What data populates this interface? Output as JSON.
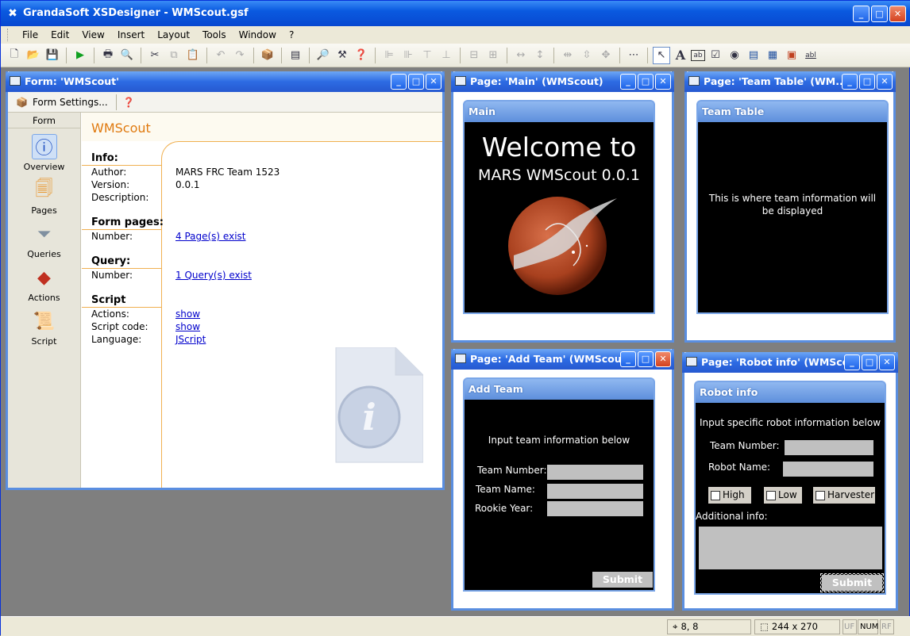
{
  "app": {
    "title": "GrandaSoft XSDesigner - WMScout.gsf"
  },
  "menu": [
    "File",
    "Edit",
    "View",
    "Insert",
    "Layout",
    "Tools",
    "Window",
    "?"
  ],
  "form_window": {
    "title": "Form: 'WMScout'",
    "toolbar_label": "Form Settings...",
    "sidebar_header": "Form",
    "sidebar_items": [
      "Overview",
      "Pages",
      "Queries",
      "Actions",
      "Script"
    ],
    "heading": "WMScout",
    "sections": {
      "info": "Info:",
      "form_pages": "Form pages:",
      "query": "Query:",
      "script": "Script"
    },
    "labels": {
      "author": "Author:",
      "version": "Version:",
      "description": "Description:",
      "pages_number": "Number:",
      "query_number": "Number:",
      "actions": "Actions:",
      "script_code": "Script code:",
      "language": "Language:"
    },
    "values": {
      "author": "MARS FRC Team 1523",
      "version": "0.0.1",
      "pages_link": "4 Page(s) exist",
      "query_link": "1 Query(s) exist",
      "actions_link": "show",
      "script_code_link": "show",
      "language_link": "JScript"
    }
  },
  "page_main": {
    "title": "Page: 'Main' (WMScout)",
    "panel_title": "Main",
    "welcome": "Welcome to",
    "subtitle": "MARS WMScout 0.0.1"
  },
  "page_team_table": {
    "title": "Page: 'Team Table' (WM...",
    "panel_title": "Team Table",
    "text": "This is where team information will be displayed"
  },
  "page_add_team": {
    "title": "Page: 'Add Team' (WMScout)",
    "panel_title": "Add Team",
    "intro": "Input team information below",
    "fields": [
      "Team Number:",
      "Team Name:",
      "Rookie Year:"
    ],
    "submit": "Submit"
  },
  "page_robot_info": {
    "title": "Page: 'Robot info' (WMSco...",
    "panel_title": "Robot info",
    "intro": "Input specific robot information below",
    "fields": [
      "Team Number:",
      "Robot Name:"
    ],
    "checkboxes": [
      "High",
      "Low",
      "Harvester"
    ],
    "additional": "Additional info:",
    "submit": "Submit"
  },
  "status": {
    "position": "8, 8",
    "size": "244 x 270",
    "uf": "UF",
    "num": "NUM",
    "rf": "RF"
  },
  "colors": {
    "titlebar": "#0a5ae0",
    "accent": "#e07a10",
    "link": "#0000cc",
    "page_bg": "#000000"
  }
}
